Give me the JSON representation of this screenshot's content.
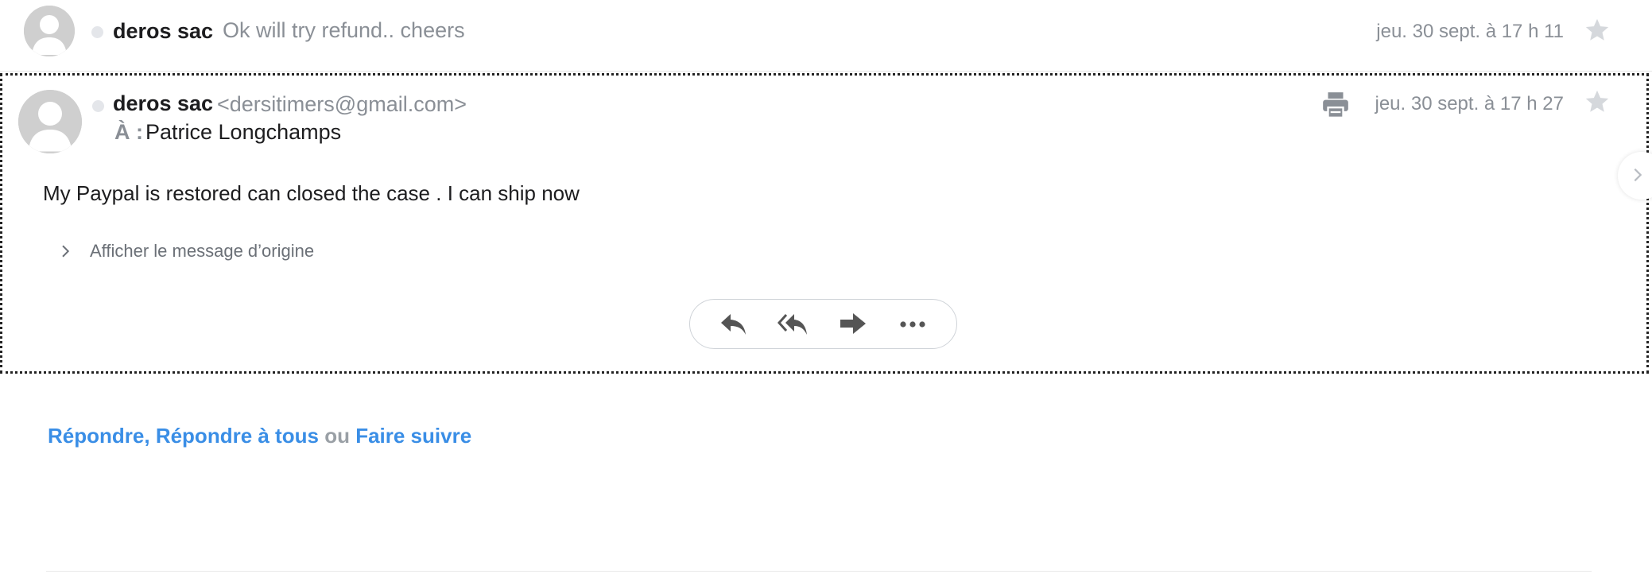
{
  "collapsed_message": {
    "sender": "deros sac",
    "snippet": "Ok will try refund.. cheers",
    "date": "jeu. 30 sept. à 17 h 11"
  },
  "expanded_message": {
    "sender": "deros sac",
    "email": "<dersitimers@gmail.com>",
    "to_label": "À :",
    "to_name": "Patrice Longchamps",
    "date": "jeu. 30 sept. à 17 h 27",
    "body": "My Paypal is restored can closed the case . I can ship now",
    "show_original": "Afficher le message d’origine",
    "actions": [
      "reply-icon",
      "reply-all-icon",
      "forward-icon",
      "more-icon"
    ]
  },
  "reply_links": {
    "reply": "Répondre,",
    "reply_all": "Répondre à tous",
    "or": "ou",
    "forward": "Faire suivre"
  },
  "colors": {
    "link": "#3a8ee6",
    "muted_text": "#8a8f96",
    "icon_dark": "#555555"
  }
}
